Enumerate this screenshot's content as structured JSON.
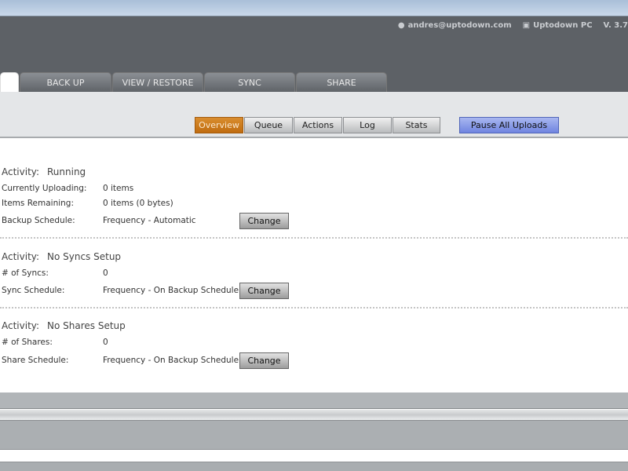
{
  "header": {
    "user_email": "andres@uptodown.com",
    "computer_name": "Uptodown PC",
    "version": "V. 3.7"
  },
  "tabs": [
    {
      "label": ""
    },
    {
      "label": "BACK UP"
    },
    {
      "label": "VIEW / RESTORE"
    },
    {
      "label": "SYNC"
    },
    {
      "label": "SHARE"
    }
  ],
  "toolbar": {
    "buttons": [
      {
        "label": "Overview",
        "active": true
      },
      {
        "label": "Queue"
      },
      {
        "label": "Actions"
      },
      {
        "label": "Log"
      },
      {
        "label": "Stats"
      }
    ],
    "pause_label": "Pause All Uploads"
  },
  "sections": [
    {
      "activity_label": "Activity:",
      "activity": "Running",
      "rows": [
        {
          "label": "Currently Uploading:",
          "value": "0 items"
        },
        {
          "label": "Items Remaining:",
          "value": "0 items (0 bytes)"
        },
        {
          "label": "Backup Schedule:",
          "value": "Frequency - Automatic"
        }
      ],
      "button": "Change"
    },
    {
      "activity_label": "Activity:",
      "activity": "No Syncs Setup",
      "rows": [
        {
          "label": "# of Syncs:",
          "value": "0"
        },
        {
          "label": "Sync Schedule:",
          "value": "Frequency - On Backup Schedule"
        }
      ],
      "button": "Change"
    },
    {
      "activity_label": "Activity:",
      "activity": "No Shares Setup",
      "rows": [
        {
          "label": "# of Shares:",
          "value": "0"
        },
        {
          "label": "Share Schedule:",
          "value": "Frequency - On Backup Schedule"
        }
      ],
      "button": "Change"
    }
  ],
  "colors": {
    "accent_active": "#c97716",
    "pause_button": "#7a8de3",
    "header_bg": "#5d6166"
  }
}
